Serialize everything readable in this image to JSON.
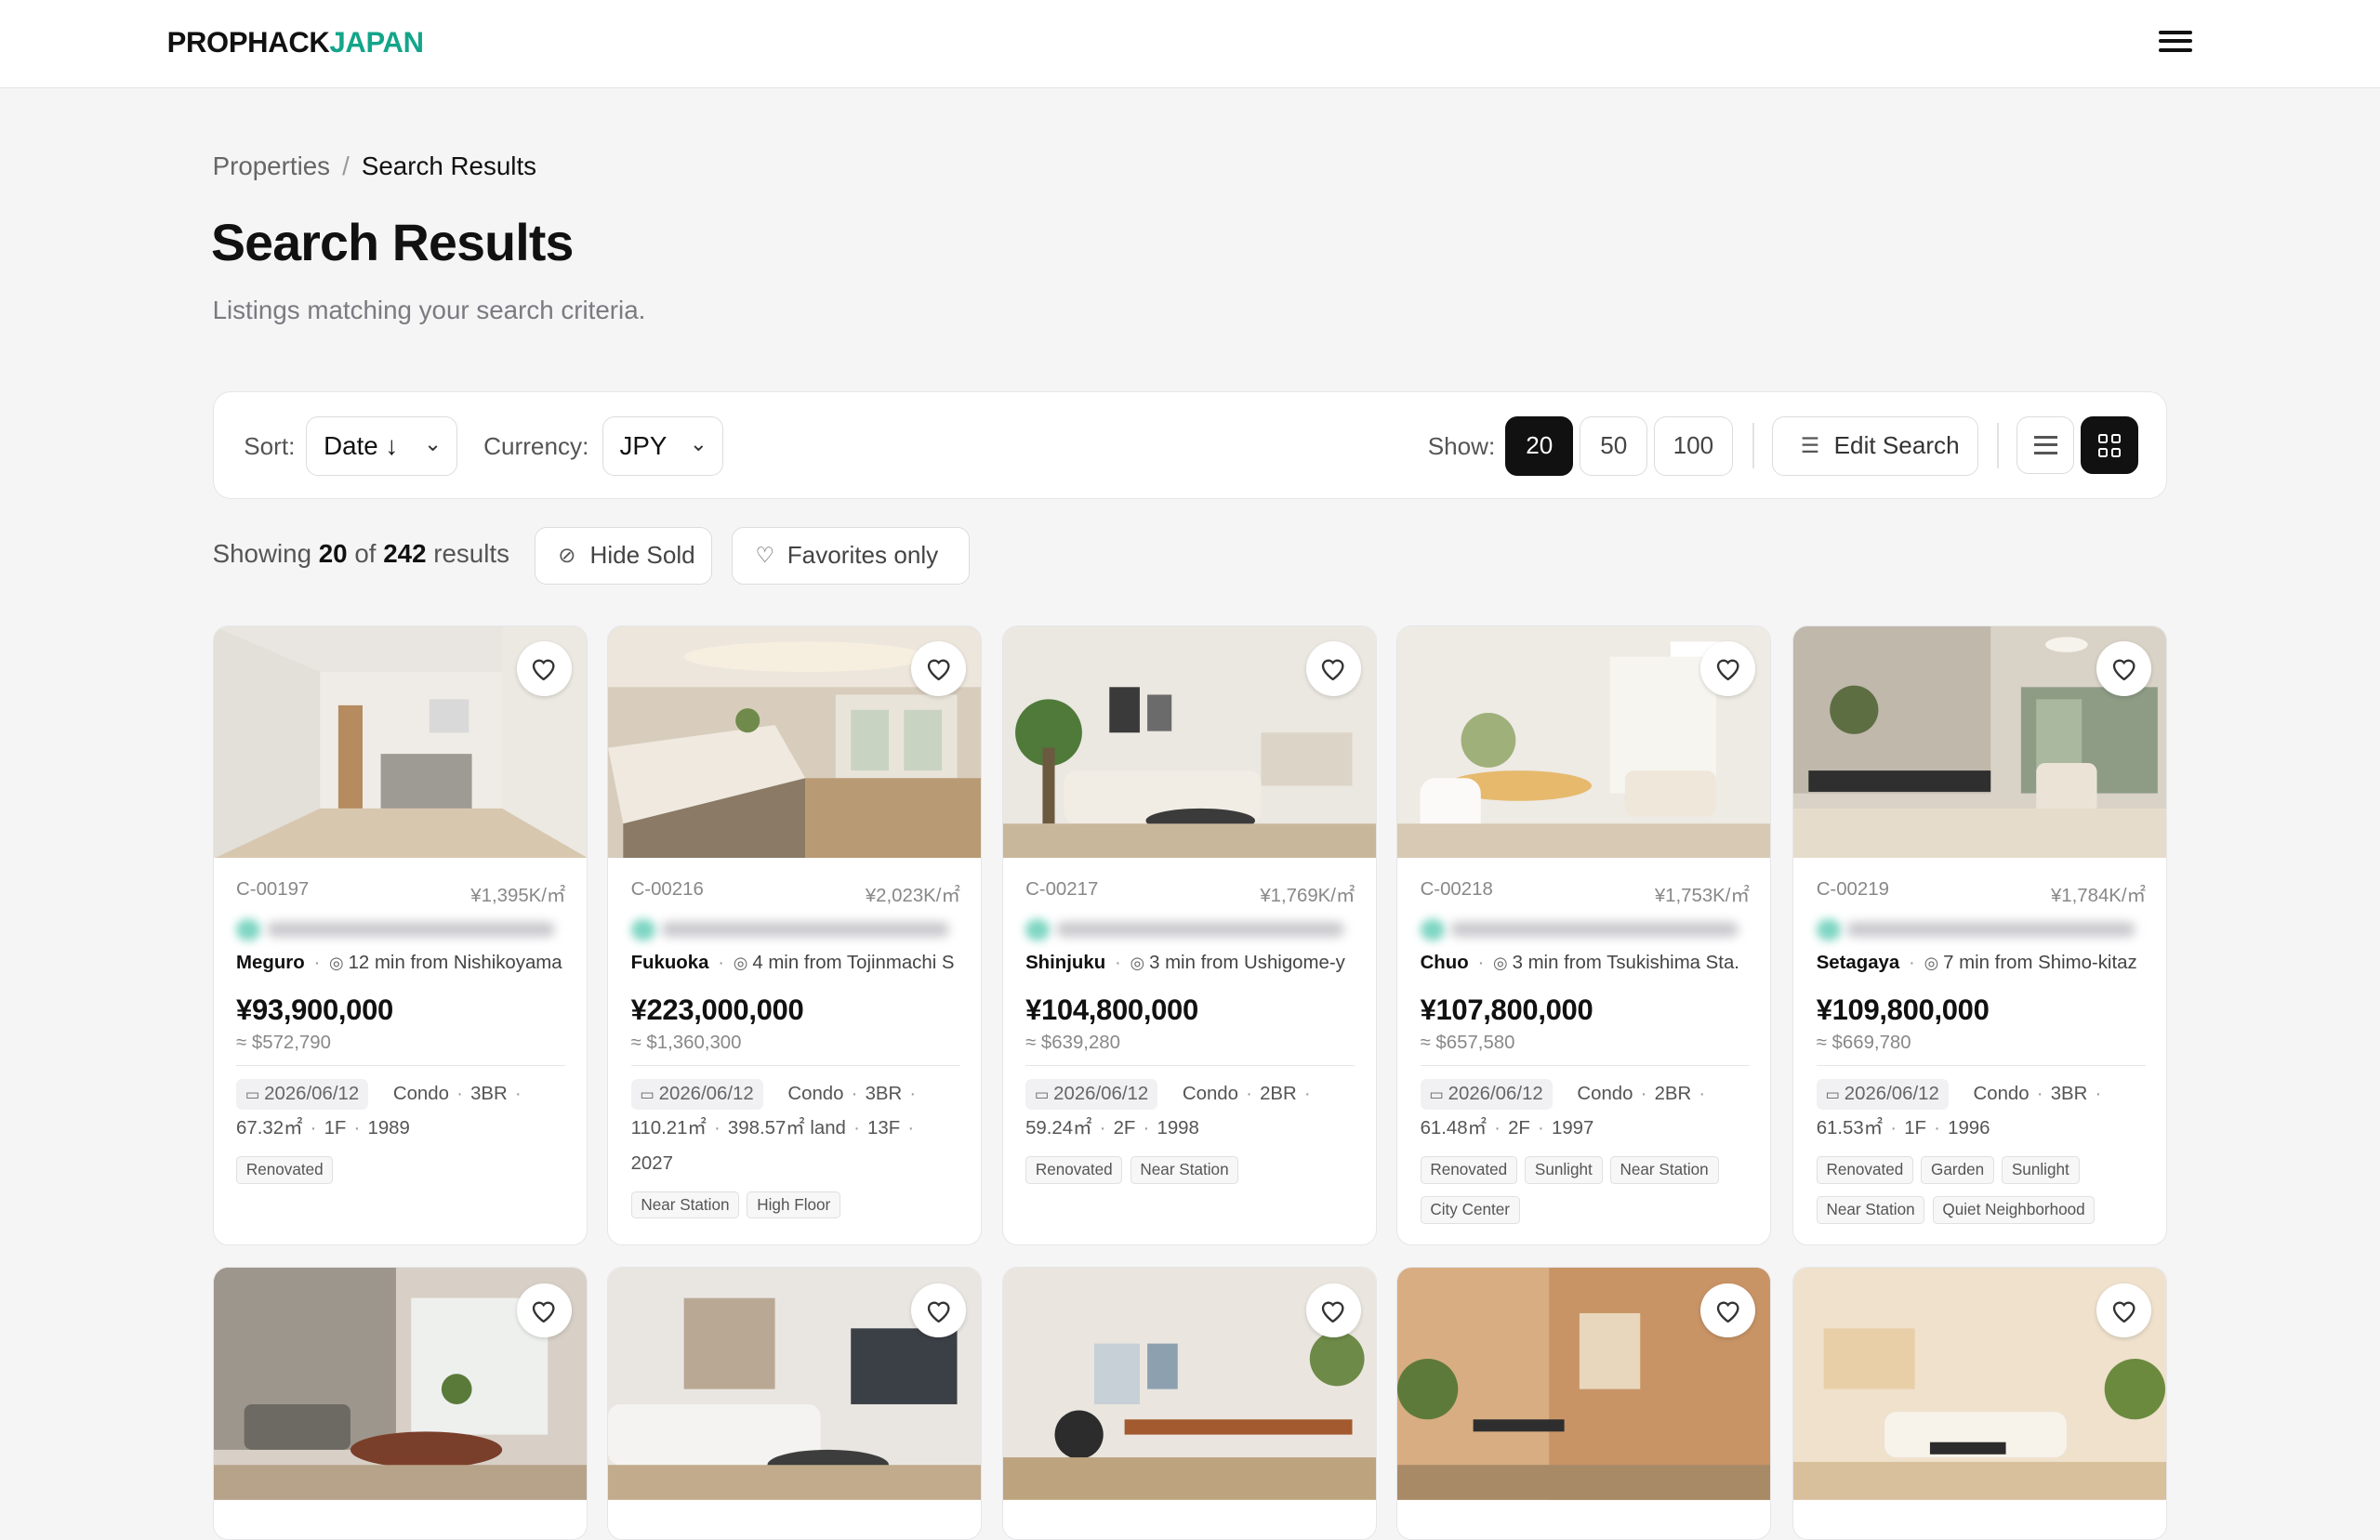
{
  "brand": {
    "part1": "PROPHACK",
    "part2": "JAPAN"
  },
  "breadcrumb": {
    "root": "Properties",
    "sep": "/",
    "current": "Search Results"
  },
  "page": {
    "title": "Search Results",
    "subtitle": "Listings matching your search criteria."
  },
  "toolbar": {
    "sort_label": "Sort:",
    "sort_value": "Date ↓",
    "currency_label": "Currency:",
    "currency_value": "JPY",
    "show_label": "Show:",
    "show_options": [
      "20",
      "50",
      "100"
    ],
    "show_selected": "20",
    "edit_search": "Edit Search"
  },
  "results": {
    "prefix": "Showing",
    "count": "20",
    "of": "of",
    "total": "242",
    "suffix": "results",
    "hide_sold": "Hide Sold",
    "favorites_only": "Favorites only"
  },
  "listings": [
    {
      "code": "C-00197",
      "ppm": "¥1,395K/㎡",
      "area": "Meguro",
      "access": "12 min from Nishikoyama",
      "price": "¥93,900,000",
      "usd": "≈ $572,790",
      "date": "2026/06/12",
      "type": "Condo",
      "rooms": "3BR",
      "size": "67.32㎡",
      "land": "",
      "floor": "1F",
      "year": "1989",
      "tags": [
        "Renovated"
      ]
    },
    {
      "code": "C-00216",
      "ppm": "¥2,023K/㎡",
      "area": "Fukuoka",
      "access": "4 min from Tojinmachi S",
      "price": "¥223,000,000",
      "usd": "≈ $1,360,300",
      "date": "2026/06/12",
      "type": "Condo",
      "rooms": "3BR",
      "size": "110.21㎡",
      "land": "398.57㎡ land",
      "floor": "13F",
      "year": "2027",
      "tags": [
        "Near Station",
        "High Floor"
      ]
    },
    {
      "code": "C-00217",
      "ppm": "¥1,769K/㎡",
      "area": "Shinjuku",
      "access": "3 min from Ushigome-y",
      "price": "¥104,800,000",
      "usd": "≈ $639,280",
      "date": "2026/06/12",
      "type": "Condo",
      "rooms": "2BR",
      "size": "59.24㎡",
      "land": "",
      "floor": "2F",
      "year": "1998",
      "tags": [
        "Renovated",
        "Near Station"
      ]
    },
    {
      "code": "C-00218",
      "ppm": "¥1,753K/㎡",
      "area": "Chuo",
      "access": "3 min from Tsukishima Sta.",
      "price": "¥107,800,000",
      "usd": "≈ $657,580",
      "date": "2026/06/12",
      "type": "Condo",
      "rooms": "2BR",
      "size": "61.48㎡",
      "land": "",
      "floor": "2F",
      "year": "1997",
      "tags": [
        "Renovated",
        "Sunlight",
        "Near Station",
        "City Center"
      ]
    },
    {
      "code": "C-00219",
      "ppm": "¥1,784K/㎡",
      "area": "Setagaya",
      "access": "7 min from Shimo-kitaz",
      "price": "¥109,800,000",
      "usd": "≈ $669,780",
      "date": "2026/06/12",
      "type": "Condo",
      "rooms": "3BR",
      "size": "61.53㎡",
      "land": "",
      "floor": "1F",
      "year": "1996",
      "tags": [
        "Renovated",
        "Garden",
        "Sunlight",
        "Near Station",
        "Quiet Neighborhood"
      ]
    }
  ],
  "colors": {
    "accent": "#13a58a",
    "active": "#111111",
    "background": "#f5f5f6"
  }
}
